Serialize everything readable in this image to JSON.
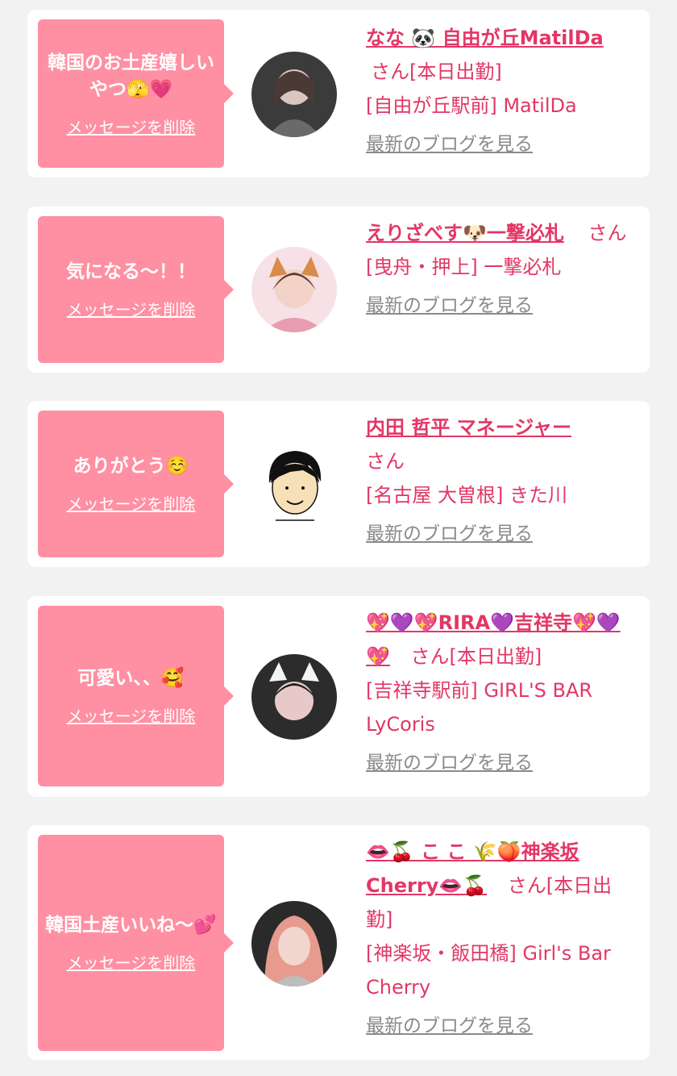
{
  "common": {
    "delete_label": "メッセージを削除",
    "blog_label": "最新のブログを見る"
  },
  "messages": [
    {
      "bubble": "韓国のお土産嬉しいやつ🫣💗",
      "name": "なな 🐼 自由が丘MatilDa",
      "suffix": "さん[本日出勤]",
      "shop": "[自由が丘駅前] MatilDa",
      "avatar_colors": [
        "#3b3b3b",
        "#d9c6c0"
      ]
    },
    {
      "bubble": "気になる〜！！",
      "name": "えりざべす🐶一撃必札",
      "suffix": "さん",
      "shop": "[曳舟・押上] 一撃必札",
      "avatar_colors": [
        "#f2b8c6",
        "#f6e2e6"
      ]
    },
    {
      "bubble": "ありがとう☺️",
      "name": "内田 哲平 マネージャー",
      "suffix": "さん",
      "shop": "[名古屋 大曽根] きた川",
      "avatar_colors": [
        "#ffffff",
        "#111111"
      ]
    },
    {
      "bubble": "可愛い、、🥰",
      "name": "💖💜💖RIRA💜吉祥寺💖💜💖",
      "suffix": "さん[本日出勤]",
      "shop": "[吉祥寺駅前] GIRL'S BAR LyCoris",
      "avatar_colors": [
        "#2c2c2c",
        "#e8c9c9"
      ]
    },
    {
      "bubble": "韓国土産いいね〜💕",
      "name": "👄🍒 こ こ 🌾🍑神楽坂Cherry👄🍒",
      "suffix": "さん[本日出勤]",
      "shop": "[神楽坂・飯田橋] Girl's Bar Cherry",
      "avatar_colors": [
        "#2a2a2a",
        "#e79a8e"
      ]
    }
  ]
}
